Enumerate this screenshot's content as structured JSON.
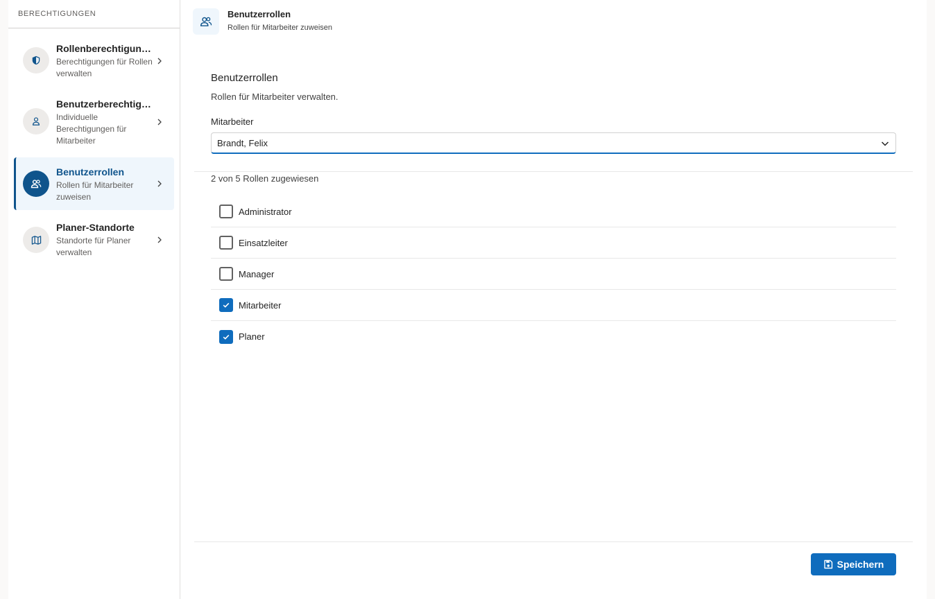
{
  "sidebar": {
    "header": "BERECHTIGUNGEN",
    "items": [
      {
        "title": "Rollenberechtigungen",
        "desc": "Berechtigungen für Rollen verwalten",
        "icon": "shield-icon"
      },
      {
        "title": "Benutzerberechtigungen",
        "desc": "Individuelle Berechtigungen für Mitarbeiter",
        "icon": "person-icon"
      },
      {
        "title": "Benutzerrollen",
        "desc": "Rollen für Mitarbeiter zuweisen",
        "icon": "people-icon",
        "active": true
      },
      {
        "title": "Planer-Standorte",
        "desc": "Standorte für Planer verwalten",
        "icon": "map-icon"
      }
    ]
  },
  "page_header": {
    "title": "Benutzerrollen",
    "subtitle": "Rollen für Mitarbeiter zuweisen",
    "icon": "people-icon"
  },
  "main": {
    "section_title": "Benutzerrollen",
    "section_subtitle": "Rollen für Mitarbeiter verwalten.",
    "employee_label": "Mitarbeiter",
    "employee_selected": "Brandt, Felix",
    "assigned_count_text": "2 von 5 Rollen zugewiesen",
    "roles": [
      {
        "label": "Administrator",
        "checked": false
      },
      {
        "label": "Einsatzleiter",
        "checked": false
      },
      {
        "label": "Manager",
        "checked": false
      },
      {
        "label": "Mitarbeiter",
        "checked": true
      },
      {
        "label": "Planer",
        "checked": true
      }
    ],
    "save_label": "Speichern"
  },
  "colors": {
    "accent": "#0f6cbd",
    "nav_active": "#0f548c",
    "nav_active_bg": "#eff6fc"
  }
}
